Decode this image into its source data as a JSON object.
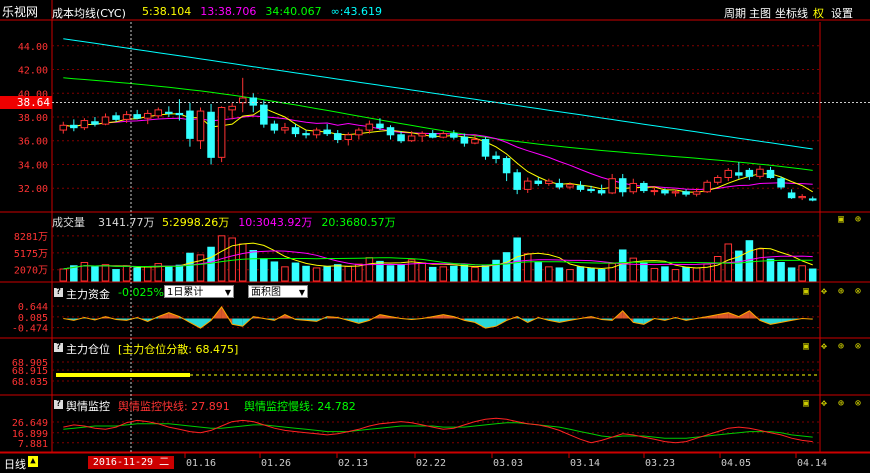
{
  "app": {
    "logo": "乐视网"
  },
  "header": {
    "indicator": "成本均线(CYC)",
    "legend": [
      {
        "label": "5:38.104",
        "color": "#ffff00"
      },
      {
        "label": "13:38.706",
        "color": "#ff00ff"
      },
      {
        "label": "34:40.067",
        "color": "#00ff00"
      },
      {
        "label": "∞:43.619",
        "color": "#00ffff"
      }
    ],
    "nav": [
      "周期",
      "主图",
      "坐标线",
      "权",
      "设置"
    ]
  },
  "main_axis": {
    "ticks": [
      "44.00",
      "42.00",
      "40.00",
      "38.00",
      "36.00",
      "34.00",
      "32.00"
    ],
    "current_price": "38.64"
  },
  "volume": {
    "title": "成交量",
    "value": "3141.77万",
    "ma": [
      {
        "label": "5:2998.26万",
        "color": "#ffff00"
      },
      {
        "label": "10:3043.92万",
        "color": "#ff00ff"
      },
      {
        "label": "20:3680.57万",
        "color": "#00ff00"
      }
    ],
    "ticks": [
      "8281万",
      "5175万",
      "2070万"
    ]
  },
  "capital": {
    "title": "主力资金",
    "value": "-0.025%",
    "select1": "1日累计",
    "select2": "面积图",
    "ticks": [
      "0.644",
      "0.085",
      "-0.474"
    ]
  },
  "position": {
    "title": "主力仓位",
    "subtitle": "[主力仓位分散: 68.475]",
    "ticks": [
      "68.905",
      "68.915",
      "68.035"
    ]
  },
  "sentiment": {
    "title": "舆情监控",
    "fast": "舆情监控快线: 27.891",
    "slow": "舆情监控慢线: 24.782",
    "ticks": [
      "26.649",
      "16.899",
      "7.881"
    ]
  },
  "footer": {
    "period": "日线",
    "date": "2016-11-29 二",
    "dates": [
      "01.16",
      "01.26",
      "02.13",
      "02.22",
      "03.03",
      "03.14",
      "03.23",
      "04.05",
      "04.14"
    ]
  },
  "colors": {
    "up": "#ff3333",
    "down": "#33ffff",
    "grid": "#800000",
    "axis": "#cc0000"
  },
  "chart_data": {
    "type": "candlestick",
    "ylim": [
      30.5,
      45.5
    ],
    "candles": [
      [
        36.9,
        37.6,
        36.6,
        37.3
      ],
      [
        37.3,
        37.8,
        36.8,
        37.1
      ],
      [
        37.1,
        37.9,
        36.9,
        37.7
      ],
      [
        37.6,
        38.0,
        37.2,
        37.4
      ],
      [
        37.4,
        38.3,
        37.3,
        38.0
      ],
      [
        38.1,
        38.4,
        37.6,
        37.8
      ],
      [
        37.8,
        38.5,
        37.5,
        38.2
      ],
      [
        38.2,
        38.6,
        37.8,
        37.9
      ],
      [
        37.9,
        38.6,
        37.4,
        38.3
      ],
      [
        38.1,
        38.8,
        37.9,
        38.6
      ],
      [
        38.4,
        38.9,
        38.0,
        38.3
      ],
      [
        38.3,
        39.5,
        37.7,
        38.2
      ],
      [
        38.5,
        39.2,
        35.5,
        36.2
      ],
      [
        36.0,
        38.8,
        35.3,
        38.5
      ],
      [
        38.4,
        39.1,
        34.0,
        34.6
      ],
      [
        34.6,
        38.9,
        34.2,
        38.8
      ],
      [
        38.6,
        39.2,
        37.8,
        38.9
      ],
      [
        39.2,
        41.3,
        38.4,
        39.6
      ],
      [
        39.6,
        40.0,
        38.4,
        39.0
      ],
      [
        39.0,
        39.4,
        37.1,
        37.4
      ],
      [
        37.4,
        37.7,
        36.6,
        36.9
      ],
      [
        36.9,
        37.5,
        36.6,
        37.1
      ],
      [
        37.1,
        37.4,
        36.3,
        36.6
      ],
      [
        36.6,
        36.9,
        36.2,
        36.5
      ],
      [
        36.5,
        37.1,
        36.2,
        36.9
      ],
      [
        36.9,
        37.4,
        36.4,
        36.6
      ],
      [
        36.6,
        36.9,
        35.8,
        36.1
      ],
      [
        36.1,
        36.7,
        35.6,
        36.5
      ],
      [
        36.5,
        37.1,
        36.1,
        36.9
      ],
      [
        36.9,
        37.7,
        36.6,
        37.4
      ],
      [
        37.4,
        37.9,
        36.9,
        37.1
      ],
      [
        37.1,
        37.3,
        36.1,
        36.5
      ],
      [
        36.5,
        36.8,
        35.8,
        36.0
      ],
      [
        36.0,
        36.8,
        35.9,
        36.4
      ],
      [
        36.4,
        36.8,
        35.9,
        36.6
      ],
      [
        36.6,
        36.9,
        36.2,
        36.3
      ],
      [
        36.3,
        36.8,
        36.2,
        36.6
      ],
      [
        36.6,
        36.9,
        36.1,
        36.3
      ],
      [
        36.3,
        36.6,
        35.5,
        35.8
      ],
      [
        35.8,
        36.5,
        35.7,
        36.1
      ],
      [
        36.1,
        36.3,
        34.4,
        34.7
      ],
      [
        34.7,
        35.1,
        34.1,
        34.5
      ],
      [
        34.5,
        34.7,
        32.6,
        33.3
      ],
      [
        33.3,
        33.6,
        31.5,
        31.9
      ],
      [
        31.9,
        32.9,
        31.6,
        32.6
      ],
      [
        32.6,
        32.9,
        32.2,
        32.4
      ],
      [
        32.4,
        32.8,
        32.2,
        32.6
      ],
      [
        32.4,
        32.8,
        31.9,
        32.1
      ],
      [
        32.1,
        32.5,
        31.9,
        32.3
      ],
      [
        32.2,
        32.6,
        31.7,
        31.9
      ],
      [
        31.9,
        32.2,
        31.6,
        31.8
      ],
      [
        31.8,
        32.3,
        31.4,
        31.6
      ],
      [
        31.6,
        33.2,
        31.5,
        32.8
      ],
      [
        32.8,
        33.2,
        31.3,
        31.7
      ],
      [
        31.7,
        32.8,
        31.5,
        32.4
      ],
      [
        32.4,
        32.6,
        31.6,
        31.8
      ],
      [
        31.8,
        32.1,
        31.4,
        31.8
      ],
      [
        31.8,
        32.0,
        31.4,
        31.6
      ],
      [
        31.6,
        31.9,
        31.3,
        31.7
      ],
      [
        31.7,
        31.9,
        31.3,
        31.5
      ],
      [
        31.5,
        32.0,
        31.3,
        31.7
      ],
      [
        31.7,
        32.7,
        31.6,
        32.5
      ],
      [
        32.5,
        33.1,
        32.3,
        32.9
      ],
      [
        32.9,
        33.7,
        32.6,
        33.5
      ],
      [
        33.3,
        34.2,
        32.8,
        33.1
      ],
      [
        33.5,
        33.7,
        32.7,
        33.0
      ],
      [
        33.0,
        33.9,
        32.8,
        33.6
      ],
      [
        33.5,
        33.8,
        32.8,
        32.9
      ],
      [
        32.8,
        33.0,
        31.9,
        32.1
      ],
      [
        31.6,
        31.9,
        31.1,
        31.2
      ],
      [
        31.2,
        31.5,
        31.0,
        31.3
      ],
      [
        31.1,
        31.3,
        30.9,
        31.0
      ]
    ],
    "volume": [
      2200,
      2800,
      3400,
      2600,
      3000,
      2100,
      2800,
      2400,
      2600,
      3200,
      2700,
      2900,
      5100,
      4800,
      6200,
      8300,
      7900,
      6800,
      5600,
      4100,
      3500,
      2600,
      3300,
      2700,
      2400,
      2600,
      3000,
      2700,
      3100,
      4300,
      3600,
      2800,
      3000,
      3900,
      3300,
      2500,
      2600,
      2700,
      2900,
      2500,
      2800,
      3800,
      5200,
      7900,
      5000,
      3500,
      2600,
      2400,
      2100,
      2600,
      2300,
      2100,
      3200,
      5700,
      4200,
      3300,
      2300,
      2600,
      2100,
      2500,
      2400,
      3100,
      4500,
      6800,
      5500,
      7400,
      5900,
      4000,
      3400,
      2400,
      2800,
      2200
    ],
    "capital": [
      0.0,
      -0.1,
      0.05,
      -0.08,
      0.1,
      -0.05,
      -0.1,
      0.05,
      -0.15,
      0.1,
      0.3,
      0.1,
      -0.2,
      -0.5,
      -0.1,
      0.6,
      -0.3,
      -0.4,
      0.1,
      0.0,
      -0.1,
      0.2,
      -0.05,
      -0.1,
      -0.15,
      0.1,
      0.05,
      -0.1,
      -0.25,
      -0.1,
      0.2,
      0.1,
      0.0,
      -0.05,
      0.0,
      0.1,
      0.2,
      0.1,
      -0.1,
      -0.2,
      -0.5,
      -0.4,
      -0.1,
      0.1,
      -0.2,
      0.05,
      -0.1,
      -0.2,
      -0.1,
      0.0,
      0.1,
      -0.05,
      -0.1,
      0.4,
      -0.2,
      -0.3,
      0.0,
      -0.1,
      0.05,
      -0.1,
      0.0,
      0.1,
      0.2,
      0.3,
      0.1,
      0.4,
      -0.1,
      -0.3,
      -0.2,
      -0.1,
      0.0,
      -0.03
    ],
    "sentiment_fast": [
      22,
      24,
      23,
      21,
      20,
      22,
      26,
      28,
      27,
      25,
      22,
      20,
      18,
      17,
      19,
      23,
      27,
      28,
      27,
      24,
      21,
      19,
      18,
      17,
      16,
      15,
      16,
      18,
      20,
      23,
      25,
      26,
      27,
      26,
      24,
      22,
      20,
      21,
      24,
      27,
      29,
      30,
      29,
      27,
      25,
      24,
      22,
      19,
      15,
      11,
      8,
      10,
      13,
      16,
      15,
      13,
      11,
      9,
      8,
      9,
      12,
      15,
      18,
      21,
      22,
      21,
      19,
      17,
      15,
      12,
      10,
      9
    ],
    "sentiment_slow": [
      20,
      21,
      22,
      23,
      23,
      23,
      24,
      25,
      25,
      25,
      25,
      24,
      23,
      22,
      21,
      21,
      22,
      23,
      24,
      24,
      23,
      22,
      21,
      20,
      19,
      18,
      18,
      18,
      19,
      20,
      21,
      22,
      23,
      23,
      23,
      23,
      22,
      22,
      22,
      23,
      24,
      25,
      26,
      26,
      25,
      24,
      23,
      22,
      20,
      18,
      16,
      14,
      13,
      14,
      14,
      14,
      13,
      12,
      12,
      12,
      13,
      14,
      15,
      16,
      17,
      18,
      18,
      18,
      17,
      15,
      14,
      13
    ]
  }
}
